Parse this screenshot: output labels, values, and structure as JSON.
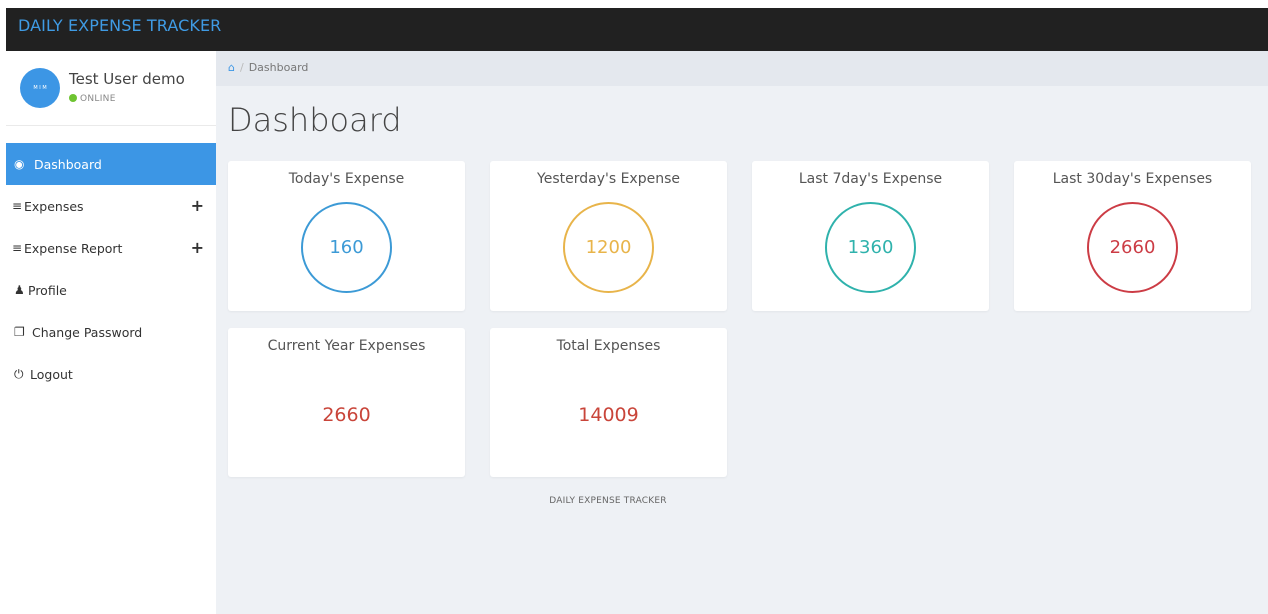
{
  "app": {
    "brand": "DAILY EXPENSE TRACKER"
  },
  "user": {
    "name": "Test User demo",
    "avatar_text": "M I M",
    "status": "ONLINE"
  },
  "sidebar": {
    "items": [
      {
        "label": "Dashboard",
        "icon": "dashboard-icon",
        "active": true
      },
      {
        "label": "Expenses",
        "icon": "list-icon",
        "expandable": true
      },
      {
        "label": "Expense Report",
        "icon": "list-icon",
        "expandable": true
      },
      {
        "label": "Profile",
        "icon": "user-icon"
      },
      {
        "label": "Change Password",
        "icon": "copy-icon"
      },
      {
        "label": "Logout",
        "icon": "power-icon"
      }
    ],
    "plus_glyph": "+"
  },
  "breadcrumb": {
    "current": "Dashboard"
  },
  "page": {
    "title": "Dashboard"
  },
  "cards": [
    {
      "title": "Today's Expense",
      "value": "160",
      "color": "#3c9ad6"
    },
    {
      "title": "Yesterday's Expense",
      "value": "1200",
      "color": "#e8b44a"
    },
    {
      "title": "Last 7day's Expense",
      "value": "1360",
      "color": "#2fb2ac"
    },
    {
      "title": "Last 30day's Expenses",
      "value": "2660",
      "color": "#cc3c45"
    },
    {
      "title": "Current Year Expenses",
      "value": "2660",
      "color": "#c9453a"
    },
    {
      "title": "Total Expenses",
      "value": "14009",
      "color": "#c9453a"
    }
  ],
  "footer": {
    "text": "DAILY EXPENSE TRACKER"
  }
}
